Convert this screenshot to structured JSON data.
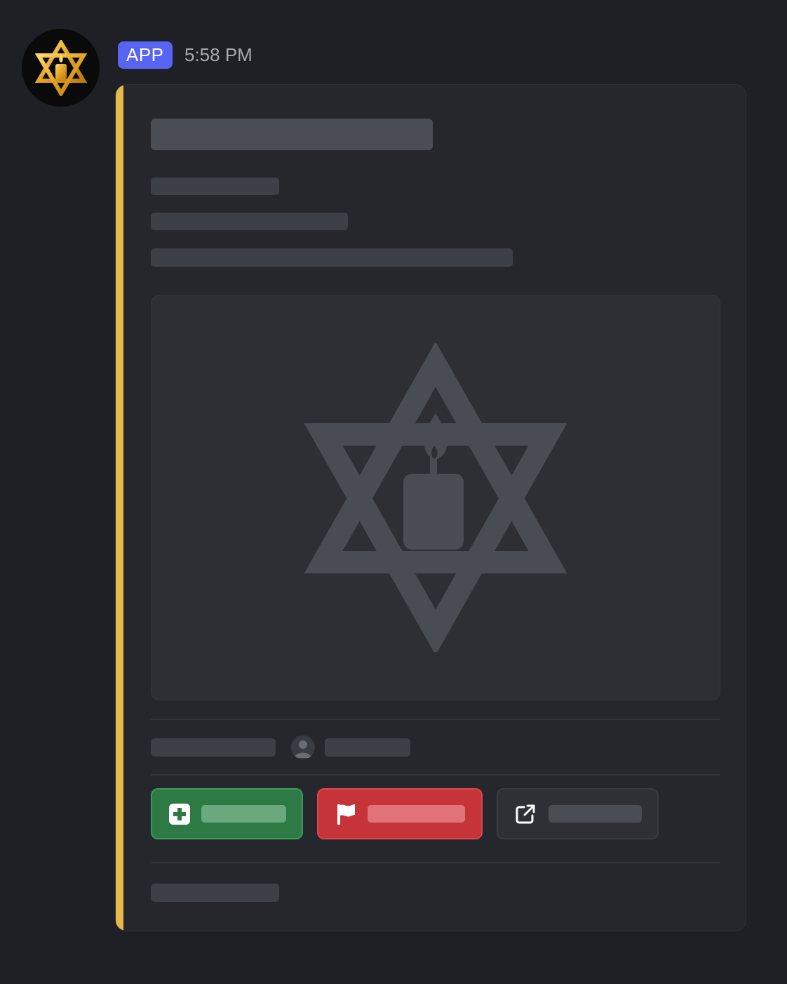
{
  "message": {
    "badge": "APP",
    "timestamp": "5:58 PM",
    "avatar_icon": "star-of-david-candle-icon"
  },
  "embed": {
    "accent_color": "#e6b94a",
    "image_icon": "star-of-david-candle-icon"
  },
  "buttons": [
    {
      "icon": "plus-square-icon",
      "color": "#2d7a45"
    },
    {
      "icon": "flag-icon",
      "color": "#c63339"
    },
    {
      "icon": "external-link-icon",
      "color": "#2e3035"
    }
  ]
}
